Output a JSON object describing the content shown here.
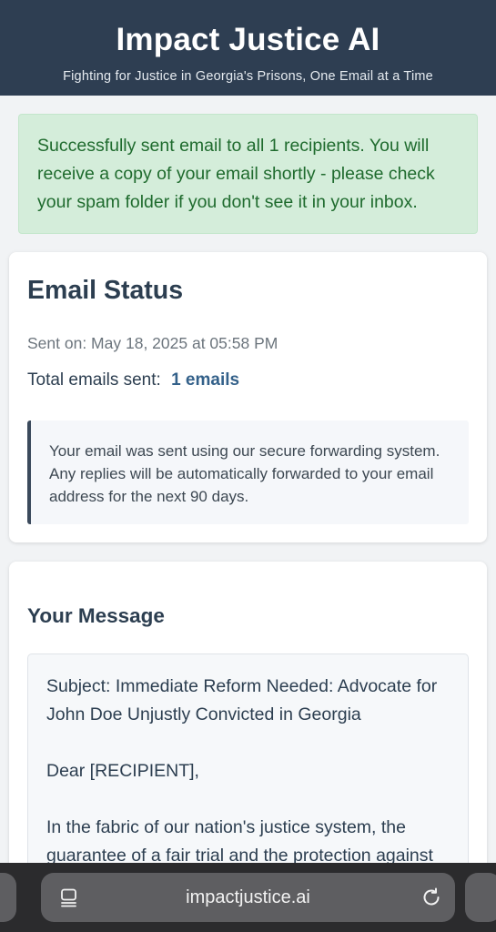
{
  "header": {
    "title": "Impact Justice AI",
    "subtitle": "Fighting for Justice in Georgia's Prisons, One Email at a Time"
  },
  "alert": {
    "message": "Successfully sent email to all 1 recipients. You will receive a copy of your email shortly - please check your spam folder if you don't see it in your inbox."
  },
  "status": {
    "heading": "Email Status",
    "sent_on": "Sent on: May 18, 2025 at 05:58 PM",
    "total_label": "Total emails sent:",
    "total_value": "1 emails",
    "note": "Your email was sent using our secure forwarding system. Any replies will be automatically forwarded to your email address for the next 90 days."
  },
  "message": {
    "heading": "Your Message",
    "paragraphs": [
      "Subject: Immediate Reform Needed: Advocate for John Doe Unjustly Convicted in Georgia",
      "Dear [RECIPIENT],",
      "In the fabric of our nation's justice system, the guarantee of a fair trial and the protection against"
    ]
  },
  "browser": {
    "url": "impactjustice.ai"
  },
  "colors": {
    "header_bg": "#2e3e52",
    "success_bg": "#d4edda",
    "success_text": "#1f6b2e",
    "accent": "#34618a"
  },
  "icons": {
    "tabs": "tabs-icon",
    "reload": "reload-icon"
  }
}
